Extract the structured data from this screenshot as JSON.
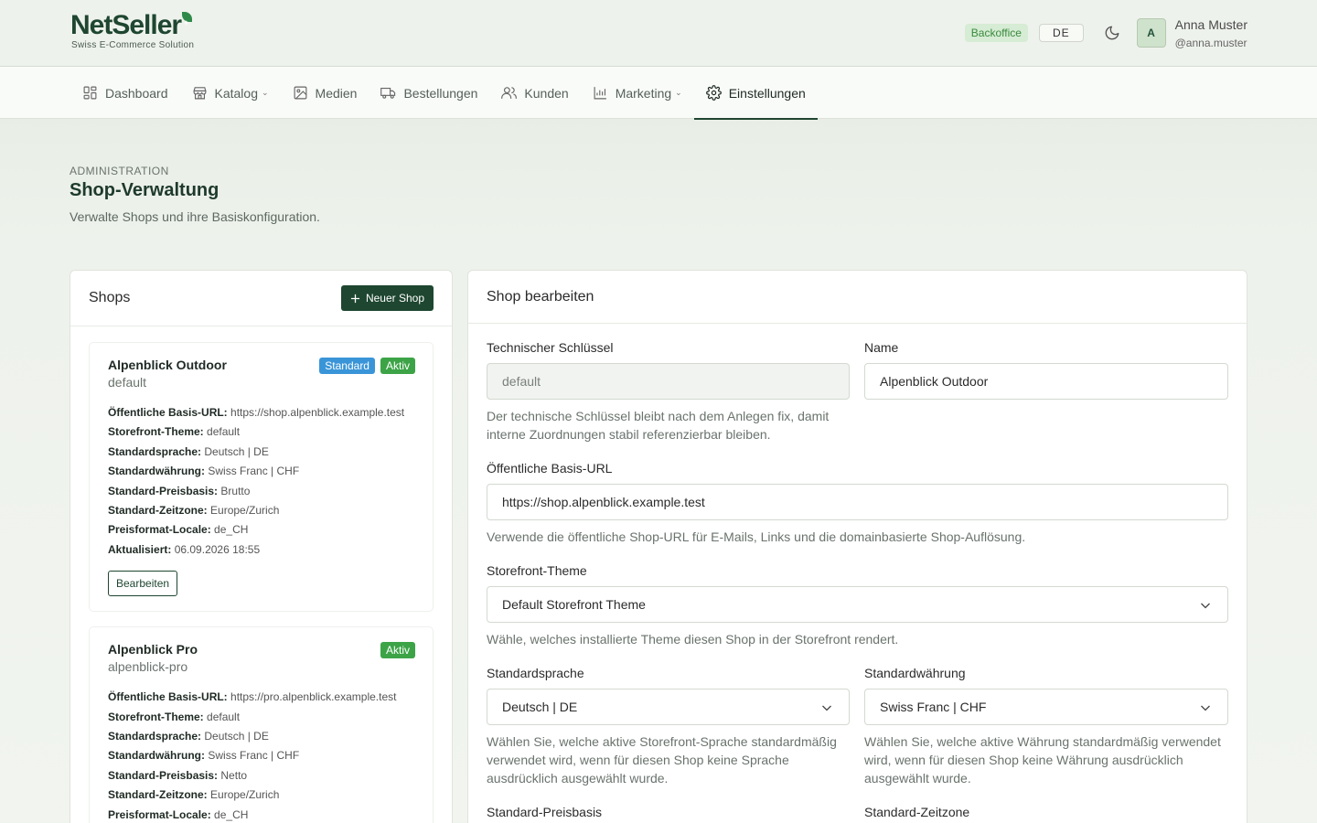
{
  "header": {
    "logo_main": "NetSeller",
    "logo_sub": "Swiss E-Commerce Solution",
    "badge": "Backoffice",
    "language": "DE",
    "avatar_initial": "A",
    "user_name": "Anna Muster",
    "user_handle": "@anna.muster"
  },
  "nav": {
    "items": [
      {
        "label": "Dashboard",
        "icon": "dashboard-icon"
      },
      {
        "label": "Katalog",
        "icon": "store-icon"
      },
      {
        "label": "Medien",
        "icon": "image-icon"
      },
      {
        "label": "Bestellungen",
        "icon": "truck-icon"
      },
      {
        "label": "Kunden",
        "icon": "users-icon"
      },
      {
        "label": "Marketing",
        "icon": "chart-icon"
      },
      {
        "label": "Einstellungen",
        "icon": "gear-icon"
      }
    ]
  },
  "page": {
    "eyebrow": "ADMINISTRATION",
    "title": "Shop-Verwaltung",
    "description": "Verwalte Shops und ihre Basiskonfiguration."
  },
  "shops_panel": {
    "title": "Shops",
    "new_button": "Neuer Shop",
    "edit_label": "Bearbeiten",
    "shops": [
      {
        "name": "Alpenblick Outdoor",
        "key": "default",
        "badges": [
          "Standard",
          "Aktiv"
        ],
        "props": [
          {
            "k": "Öffentliche Basis-URL:",
            "v": "https://shop.alpenblick.example.test"
          },
          {
            "k": "Storefront-Theme:",
            "v": "default"
          },
          {
            "k": "Standardsprache:",
            "v": "Deutsch | DE"
          },
          {
            "k": "Standardwährung:",
            "v": "Swiss Franc | CHF"
          },
          {
            "k": "Standard-Preisbasis:",
            "v": "Brutto"
          },
          {
            "k": "Standard-Zeitzone:",
            "v": "Europe/Zurich"
          },
          {
            "k": "Preisformat-Locale:",
            "v": "de_CH"
          },
          {
            "k": "Aktualisiert:",
            "v": "06.09.2026 18:55"
          }
        ]
      },
      {
        "name": "Alpenblick Pro",
        "key": "alpenblick-pro",
        "badges": [
          "Aktiv"
        ],
        "props": [
          {
            "k": "Öffentliche Basis-URL:",
            "v": "https://pro.alpenblick.example.test"
          },
          {
            "k": "Storefront-Theme:",
            "v": "default"
          },
          {
            "k": "Standardsprache:",
            "v": "Deutsch | DE"
          },
          {
            "k": "Standardwährung:",
            "v": "Swiss Franc | CHF"
          },
          {
            "k": "Standard-Preisbasis:",
            "v": "Netto"
          },
          {
            "k": "Standard-Zeitzone:",
            "v": "Europe/Zurich"
          },
          {
            "k": "Preisformat-Locale:",
            "v": "de_CH"
          }
        ]
      }
    ]
  },
  "edit_panel": {
    "title": "Shop bearbeiten",
    "tech_key_label": "Technischer Schlüssel",
    "tech_key_value": "default",
    "tech_key_help": "Der technische Schlüssel bleibt nach dem Anlegen fix, damit interne Zuordnungen stabil referenzierbar bleiben.",
    "name_label": "Name",
    "name_value": "Alpenblick Outdoor",
    "url_label": "Öffentliche Basis-URL",
    "url_value": "https://shop.alpenblick.example.test",
    "url_help": "Verwende die öffentliche Shop-URL für E-Mails, Links und die domainbasierte Shop-Auflösung.",
    "theme_label": "Storefront-Theme",
    "theme_value": "Default Storefront Theme",
    "theme_help": "Wähle, welches installierte Theme diesen Shop in der Storefront rendert.",
    "lang_label": "Standardsprache",
    "lang_value": "Deutsch | DE",
    "lang_help": "Wählen Sie, welche aktive Storefront-Sprache standardmäßig verwendet wird, wenn für diesen Shop keine Sprache ausdrücklich ausgewählt wurde.",
    "currency_label": "Standardwährung",
    "currency_value": "Swiss Franc | CHF",
    "currency_help": "Wählen Sie, welche aktive Währung standardmäßig verwendet wird, wenn für diesen Shop keine Währung ausdrücklich ausgewählt wurde.",
    "price_basis_label": "Standard-Preisbasis",
    "timezone_label": "Standard-Zeitzone"
  },
  "colors": {
    "brand": "#1e4630",
    "badge_standard": "#3a95d8",
    "badge_active": "#3ca447"
  }
}
